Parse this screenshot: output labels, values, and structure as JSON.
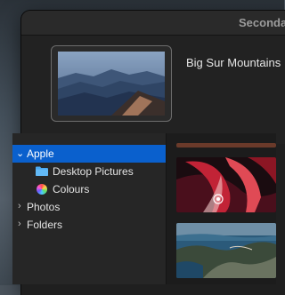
{
  "window": {
    "title": "Seconda"
  },
  "preview": {
    "name": "Big Sur Mountains"
  },
  "sidebar": {
    "items": [
      {
        "label": "Apple",
        "chevron": "chevron-down-icon",
        "selected": true
      },
      {
        "label": "Desktop Pictures",
        "icon": "folder-icon"
      },
      {
        "label": "Colours",
        "icon": "color-wheel-icon"
      },
      {
        "label": "Photos",
        "chevron": "chevron-right-icon"
      },
      {
        "label": "Folders",
        "chevron": "chevron-right-icon"
      }
    ]
  },
  "colors": {
    "selection": "#0a60cd",
    "folder": "#4aa8f0"
  }
}
